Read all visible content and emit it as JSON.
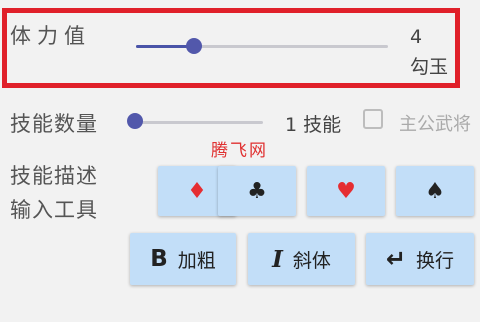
{
  "stamina": {
    "label": "体力值",
    "value": "4",
    "unit": "勾玉",
    "level": 0.24
  },
  "skills": {
    "label": "技能数量",
    "value_text": "1 技能",
    "level": 0.0
  },
  "lord_checkbox": {
    "label": "主公武将",
    "checked": false
  },
  "watermark": "腾飞网",
  "description_tools": {
    "label_line1": "技能描述",
    "label_line2": "输入工具",
    "suits": {
      "diamond": "♦",
      "club": "♣",
      "heart": "♥",
      "spade": "♠"
    },
    "suit_icons": [
      "diamond-icon",
      "club-icon",
      "heart-icon",
      "spade-icon"
    ],
    "format": {
      "bold": {
        "icon": "B",
        "label": "加粗"
      },
      "italic": {
        "icon": "I",
        "label": "斜体"
      },
      "newline": {
        "icon": "↵",
        "label": "换行"
      }
    }
  },
  "colors": {
    "highlight": "#e0202a",
    "slider": "#5258ab",
    "button_bg": "#c2def8",
    "red_suit": "#e52d32",
    "watermark": "#e03030"
  }
}
